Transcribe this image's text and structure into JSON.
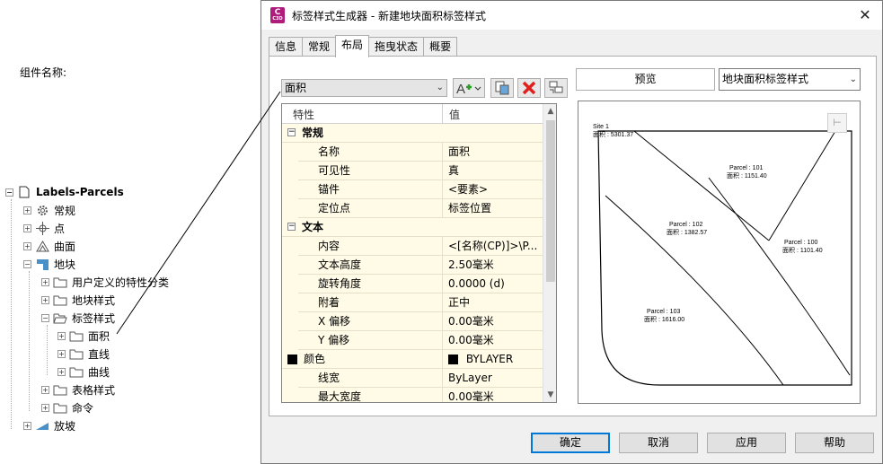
{
  "tree": {
    "root": "Labels-Parcels",
    "items": [
      {
        "label": "常规",
        "icon": "gear-icon"
      },
      {
        "label": "点",
        "icon": "point-icon"
      },
      {
        "label": "曲面",
        "icon": "surface-icon"
      },
      {
        "label": "地块",
        "icon": "parcel-icon"
      },
      {
        "label": "用户定义的特性分类",
        "icon": "folder-icon"
      },
      {
        "label": "地块样式",
        "icon": "folder-icon"
      },
      {
        "label": "标签样式",
        "icon": "folder-icon"
      },
      {
        "label": "面积",
        "icon": "folder-icon"
      },
      {
        "label": "直线",
        "icon": "folder-icon"
      },
      {
        "label": "曲线",
        "icon": "folder-icon"
      },
      {
        "label": "表格样式",
        "icon": "folder-icon"
      },
      {
        "label": "命令",
        "icon": "folder-icon"
      },
      {
        "label": "放坡",
        "icon": "grading-icon"
      }
    ]
  },
  "dialog": {
    "title": "标签样式生成器 - 新建地块面积标签样式",
    "app_icon_text": "C",
    "app_icon_sub": "C3D",
    "close": "✕",
    "tabs": [
      "信息",
      "常规",
      "布局",
      "拖曳状态",
      "概要"
    ],
    "active_tab": "布局",
    "component_label": "组件名称:",
    "component_value": "面积",
    "grid": {
      "col_property": "特性",
      "col_value": "值",
      "categories": [
        {
          "name": "常规",
          "rows": [
            {
              "name": "名称",
              "value": "面积"
            },
            {
              "name": "可见性",
              "value": "真"
            },
            {
              "name": "锚件",
              "value": "<要素>"
            },
            {
              "name": "定位点",
              "value": "标签位置"
            }
          ]
        },
        {
          "name": "文本",
          "rows": [
            {
              "name": "内容",
              "value": "<[名称(CP)]>\\P..."
            },
            {
              "name": "文本高度",
              "value": "2.50毫米"
            },
            {
              "name": "旋转角度",
              "value": "0.0000 (d)"
            },
            {
              "name": "附着",
              "value": "正中"
            },
            {
              "name": "X 偏移",
              "value": "0.00毫米"
            },
            {
              "name": "Y 偏移",
              "value": "0.00毫米"
            },
            {
              "name": "颜色",
              "value": "BYLAYER"
            },
            {
              "name": "线宽",
              "value": "ByLayer"
            },
            {
              "name": "最大宽度",
              "value": "0.00毫米"
            }
          ]
        }
      ]
    },
    "preview_label": "预览",
    "preview_style": "地块面积标签样式",
    "preview_labels": [
      {
        "line1": "Site 1",
        "line2": "面积 : 5301.37"
      },
      {
        "line1": "Parcel : 101",
        "line2": "面积 : 1151.40"
      },
      {
        "line1": "Parcel : 102",
        "line2": "面积 : 1382.57"
      },
      {
        "line1": "Parcel : 100",
        "line2": "面积 : 1101.40"
      },
      {
        "line1": "Parcel : 103",
        "line2": "面积 : 1616.00"
      }
    ],
    "buttons": {
      "ok": "确定",
      "cancel": "取消",
      "apply": "应用",
      "help": "帮助"
    }
  }
}
